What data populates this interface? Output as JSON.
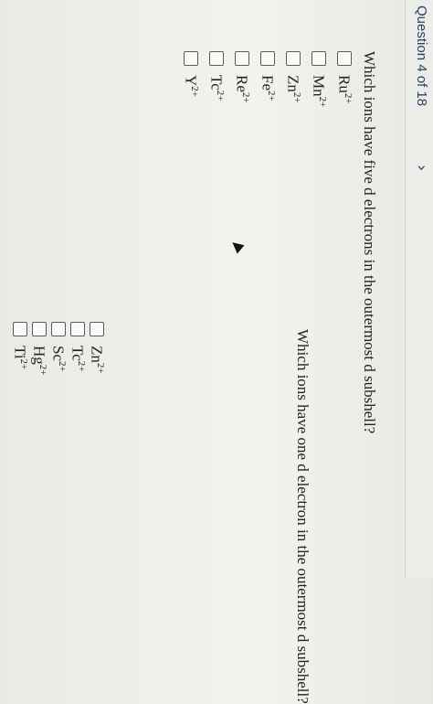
{
  "header": {
    "question_label": "Question 4 of 18",
    "next_label": "›"
  },
  "q1": {
    "text": "Which ions have five d electrons in the outermost d subshell?",
    "options": [
      {
        "base": "Ru",
        "charge": "2+"
      },
      {
        "base": "Mn",
        "charge": "2+"
      },
      {
        "base": "Zn",
        "charge": "2+"
      },
      {
        "base": "Fe",
        "charge": "2+"
      },
      {
        "base": "Re",
        "charge": "2+"
      },
      {
        "base": "Tc",
        "charge": "2+"
      },
      {
        "base": "Y",
        "charge": "2+"
      }
    ]
  },
  "q2": {
    "text": "Which ions have one d electron in the outermost d subshell?",
    "options": [
      {
        "base": "Zn",
        "charge": "2+"
      },
      {
        "base": "Tc",
        "charge": "2+"
      },
      {
        "base": "Sc",
        "charge": "2+"
      },
      {
        "base": "Hg",
        "charge": "2+"
      },
      {
        "base": "Ti",
        "charge": "2+"
      }
    ]
  }
}
